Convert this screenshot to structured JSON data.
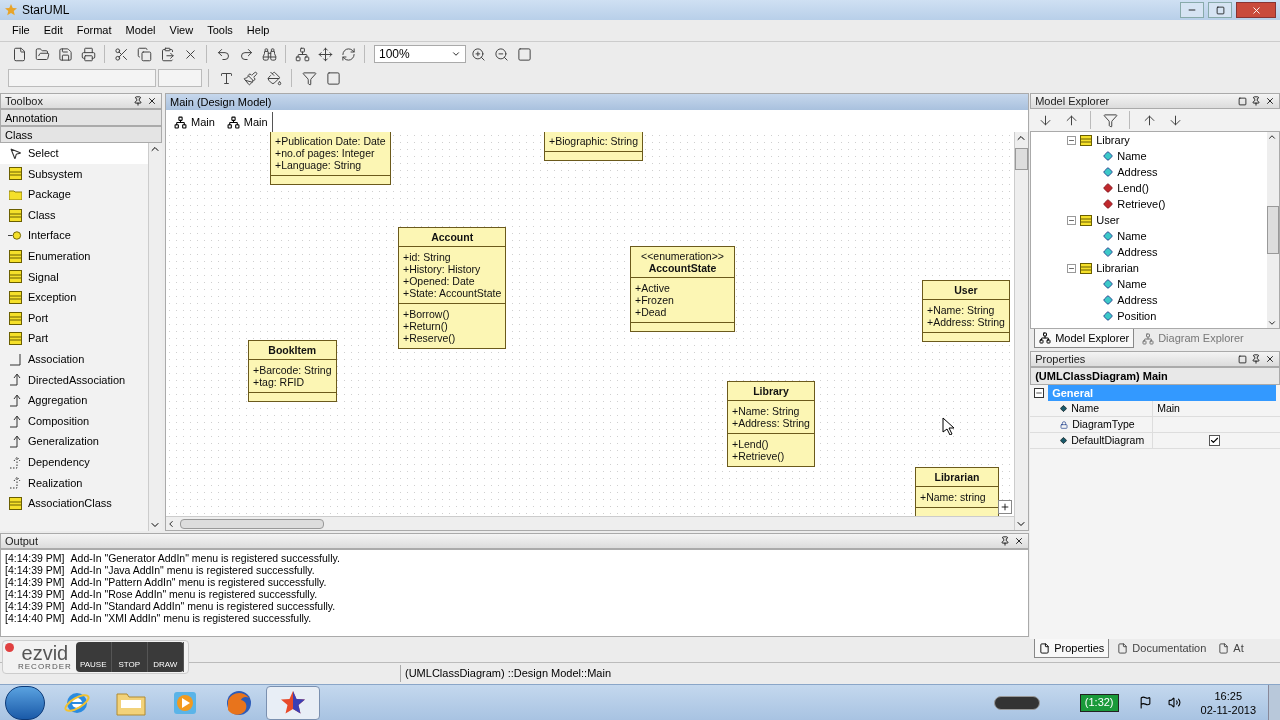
{
  "window": {
    "title": "StarUML"
  },
  "menu": [
    "File",
    "Edit",
    "Format",
    "Model",
    "View",
    "Tools",
    "Help"
  ],
  "toolbar": {
    "zoom": "100%"
  },
  "toolbox": {
    "title": "Toolbox",
    "groups": [
      "Annotation",
      "Class"
    ],
    "items": [
      {
        "label": "Select",
        "kind": "pointer",
        "selected": true
      },
      {
        "label": "Subsystem",
        "kind": "element",
        "selected": false
      },
      {
        "label": "Package",
        "kind": "folder",
        "selected": false
      },
      {
        "label": "Class",
        "kind": "element",
        "selected": false
      },
      {
        "label": "Interface",
        "kind": "lollipop",
        "selected": false
      },
      {
        "label": "Enumeration",
        "kind": "element",
        "selected": false
      },
      {
        "label": "Signal",
        "kind": "element",
        "selected": false
      },
      {
        "label": "Exception",
        "kind": "element",
        "selected": false
      },
      {
        "label": "Port",
        "kind": "element",
        "selected": false
      },
      {
        "label": "Part",
        "kind": "element",
        "selected": false
      },
      {
        "label": "Association",
        "kind": "line",
        "selected": false
      },
      {
        "label": "DirectedAssociation",
        "kind": "arrow",
        "selected": false
      },
      {
        "label": "Aggregation",
        "kind": "arrow",
        "selected": false
      },
      {
        "label": "Composition",
        "kind": "arrow",
        "selected": false
      },
      {
        "label": "Generalization",
        "kind": "arrow",
        "selected": false
      },
      {
        "label": "Dependency",
        "kind": "dashed",
        "selected": false
      },
      {
        "label": "Realization",
        "kind": "dashed",
        "selected": false
      },
      {
        "label": "AssociationClass",
        "kind": "element",
        "selected": false
      }
    ]
  },
  "editor": {
    "title": "Main (Design Model)",
    "tabs": [
      {
        "label": "Main",
        "selected": false
      },
      {
        "label": "Main",
        "selected": true
      }
    ],
    "classes": [
      {
        "attributes": [
          "+Publication Date: Date",
          "+no.of pages: Integer",
          "+Language: String"
        ]
      },
      {
        "attributes": [
          "+Biographic: String"
        ]
      },
      {
        "name": "Account",
        "attributes": [
          "+id: String",
          "+History: History",
          "+Opened: Date",
          "+State: AccountState"
        ],
        "operations": [
          "+Borrow()",
          "+Return()",
          "+Reserve()"
        ]
      },
      {
        "stereotype": "<<enumeration>>",
        "name": "AccountState",
        "attributes": [
          "+Active",
          "+Frozen",
          "+Dead"
        ]
      },
      {
        "name": "User",
        "attributes": [
          "+Name: String",
          "+Address: String"
        ]
      },
      {
        "name": "BookItem",
        "attributes": [
          "+Barcode: String",
          "+tag: RFID"
        ]
      },
      {
        "name": "Library",
        "attributes": [
          "+Name: String",
          "+Address: String"
        ],
        "operations": [
          "+Lend()",
          "+Retrieve()"
        ]
      },
      {
        "name": "Librarian",
        "attributes": [
          "+Name: string"
        ]
      }
    ]
  },
  "model_explorer": {
    "title": "Model Explorer",
    "tree": [
      {
        "label": "Library",
        "expanded": true,
        "children": [
          {
            "label": "Name",
            "kind": "attribute"
          },
          {
            "label": "Address",
            "kind": "attribute"
          },
          {
            "label": "Lend()",
            "kind": "operation"
          },
          {
            "label": "Retrieve()",
            "kind": "operation"
          }
        ]
      },
      {
        "label": "User",
        "expanded": true,
        "children": [
          {
            "label": "Name",
            "kind": "attribute"
          },
          {
            "label": "Address",
            "kind": "attribute"
          }
        ]
      },
      {
        "label": "Librarian",
        "expanded": true,
        "children": [
          {
            "label": "Name",
            "kind": "attribute"
          },
          {
            "label": "Address",
            "kind": "attribute"
          },
          {
            "label": "Position",
            "kind": "attribute"
          }
        ]
      }
    ],
    "tabs": [
      {
        "label": "Model Explorer",
        "selected": true
      },
      {
        "label": "Diagram Explorer",
        "selected": false
      }
    ]
  },
  "properties": {
    "title": "Properties",
    "subject": "(UMLClassDiagram) Main",
    "section": "General",
    "expanded": true,
    "rows": [
      {
        "name": "Name",
        "kind": "text",
        "value": "Main",
        "locked": false
      },
      {
        "name": "DiagramType",
        "kind": "text",
        "locked": true
      },
      {
        "name": "DefaultDiagram",
        "kind": "checkbox",
        "checked": true,
        "locked": false
      }
    ],
    "tabs": [
      {
        "label": "Properties",
        "selected": true
      },
      {
        "label": "Documentation",
        "selected": false
      },
      {
        "label": "At",
        "selected": false
      }
    ]
  },
  "output": {
    "title": "Output",
    "lines": [
      {
        "time": "[4:14:39 PM]",
        "message": "Add-In \"Generator AddIn\" menu is registered successfully."
      },
      {
        "time": "[4:14:39 PM]",
        "message": "Add-In \"Java AddIn\" menu is registered successfully."
      },
      {
        "time": "[4:14:39 PM]",
        "message": "Add-In \"Pattern AddIn\" menu is registered successfully."
      },
      {
        "time": "[4:14:39 PM]",
        "message": "Add-In \"Rose AddIn\" menu is registered successfully."
      },
      {
        "time": "[4:14:39 PM]",
        "message": "Add-In \"Standard AddIn\" menu is registered successfully."
      },
      {
        "time": "[4:14:40 PM]",
        "message": "Add-In \"XMI AddIn\" menu is registered successfully."
      }
    ]
  },
  "status_bar": {
    "text": "(UMLClassDiagram) ::Design Model::Main"
  },
  "recorder": {
    "logo": "ezvid",
    "subtitle": "RECORDER",
    "buttons": [
      "PAUSE",
      "STOP",
      "DRAW"
    ]
  },
  "taskbar": {
    "apps": [
      {
        "kind": "browser",
        "selected": false
      },
      {
        "kind": "folder",
        "selected": false
      },
      {
        "kind": "media",
        "selected": false
      },
      {
        "kind": "fox",
        "selected": false
      },
      {
        "kind": "star",
        "selected": true
      }
    ],
    "battery": "(1:32)",
    "time": "16:25",
    "date": "02-11-2013"
  }
}
